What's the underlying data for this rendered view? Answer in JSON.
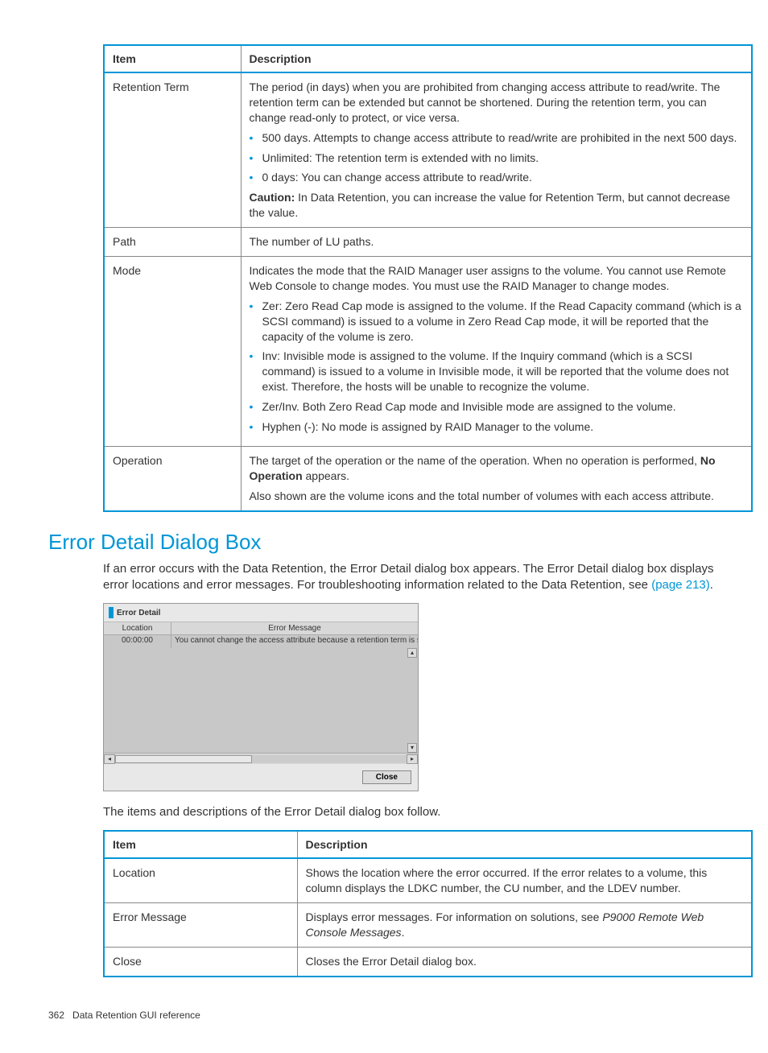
{
  "table1": {
    "headers": {
      "item": "Item",
      "desc": "Description"
    },
    "rows": {
      "retention": {
        "item": "Retention Term",
        "intro": "The period (in days) when you are prohibited from changing access attribute to read/write. The retention term can be extended but cannot be shortened. During the retention term, you can change read-only to protect, or vice versa.",
        "b1": "500 days. Attempts to change access attribute to read/write are prohibited in the next 500 days.",
        "b2": "Unlimited: The retention term is extended with no limits.",
        "b3": "0 days: You can change access attribute to read/write.",
        "caution_label": "Caution:",
        "caution": " In Data Retention, you can increase the value for Retention Term, but cannot decrease the value."
      },
      "path": {
        "item": "Path",
        "desc": "The number of LU paths."
      },
      "mode": {
        "item": "Mode",
        "intro": "Indicates the mode that the RAID Manager user assigns to the volume. You cannot use Remote Web Console to change modes. You must use the RAID Manager to change modes.",
        "b1": "Zer: Zero Read Cap mode is assigned to the volume. If the Read Capacity command (which is a SCSI command) is issued to a volume in Zero Read Cap mode, it will be reported that the capacity of the volume is zero.",
        "b2": "Inv: Invisible mode is assigned to the volume. If the Inquiry command (which is a SCSI command) is issued to a volume in Invisible mode, it will be reported that the volume does not exist. Therefore, the hosts will be unable to recognize the volume.",
        "b3": "Zer/Inv. Both Zero Read Cap mode and Invisible mode are assigned to the volume.",
        "b4": "Hyphen (-): No mode is assigned by RAID Manager to the volume."
      },
      "operation": {
        "item": "Operation",
        "p1a": "The target of the operation or the name of the operation. When no operation is performed, ",
        "p1b": "No Operation",
        "p1c": " appears.",
        "p2": "Also shown are the volume icons and the total number of volumes with each access attribute."
      }
    }
  },
  "section_title": "Error Detail Dialog Box",
  "intro_text_a": "If an error occurs with the Data Retention, the Error Detail dialog box appears. The Error Detail dialog box displays error locations and error messages. For troubleshooting information related to the Data Retention, see ",
  "intro_link": "(page 213)",
  "intro_text_b": ".",
  "dialog": {
    "title": "Error Detail",
    "col_location": "Location",
    "col_errmsg": "Error Message",
    "row_loc": "00:00:00",
    "row_msg": "You cannot change the access attribute because a retention term is set to the sp",
    "close": "Close"
  },
  "mid_text": "The items and descriptions of the Error Detail dialog box follow.",
  "table2": {
    "headers": {
      "item": "Item",
      "desc": "Description"
    },
    "rows": {
      "location": {
        "item": "Location",
        "desc": "Shows the location where the error occurred. If the error relates to a volume, this column displays the LDKC number, the CU number, and the LDEV number."
      },
      "errmsg": {
        "item": "Error Message",
        "d1": "Displays error messages. For information on solutions, see ",
        "d2": "P9000 Remote Web Console Messages",
        "d3": "."
      },
      "close": {
        "item": "Close",
        "desc": "Closes the Error Detail dialog box."
      }
    }
  },
  "footer": {
    "page": "362",
    "title": "Data Retention GUI reference"
  }
}
